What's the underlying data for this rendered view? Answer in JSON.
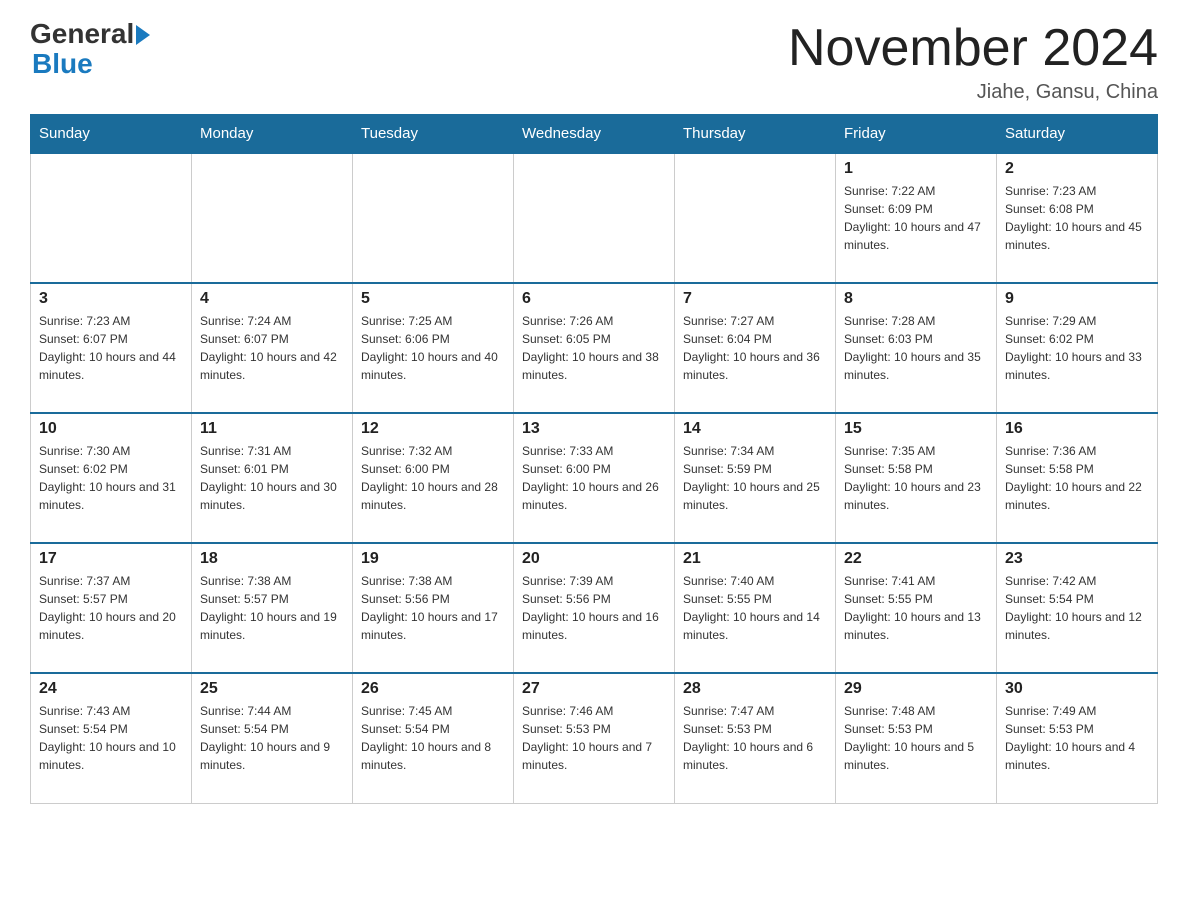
{
  "header": {
    "logo_general": "General",
    "logo_blue": "Blue",
    "month_title": "November 2024",
    "location": "Jiahe, Gansu, China"
  },
  "days_of_week": [
    "Sunday",
    "Monday",
    "Tuesday",
    "Wednesday",
    "Thursday",
    "Friday",
    "Saturday"
  ],
  "weeks": [
    [
      {
        "day": "",
        "info": ""
      },
      {
        "day": "",
        "info": ""
      },
      {
        "day": "",
        "info": ""
      },
      {
        "day": "",
        "info": ""
      },
      {
        "day": "",
        "info": ""
      },
      {
        "day": "1",
        "info": "Sunrise: 7:22 AM\nSunset: 6:09 PM\nDaylight: 10 hours and 47 minutes."
      },
      {
        "day": "2",
        "info": "Sunrise: 7:23 AM\nSunset: 6:08 PM\nDaylight: 10 hours and 45 minutes."
      }
    ],
    [
      {
        "day": "3",
        "info": "Sunrise: 7:23 AM\nSunset: 6:07 PM\nDaylight: 10 hours and 44 minutes."
      },
      {
        "day": "4",
        "info": "Sunrise: 7:24 AM\nSunset: 6:07 PM\nDaylight: 10 hours and 42 minutes."
      },
      {
        "day": "5",
        "info": "Sunrise: 7:25 AM\nSunset: 6:06 PM\nDaylight: 10 hours and 40 minutes."
      },
      {
        "day": "6",
        "info": "Sunrise: 7:26 AM\nSunset: 6:05 PM\nDaylight: 10 hours and 38 minutes."
      },
      {
        "day": "7",
        "info": "Sunrise: 7:27 AM\nSunset: 6:04 PM\nDaylight: 10 hours and 36 minutes."
      },
      {
        "day": "8",
        "info": "Sunrise: 7:28 AM\nSunset: 6:03 PM\nDaylight: 10 hours and 35 minutes."
      },
      {
        "day": "9",
        "info": "Sunrise: 7:29 AM\nSunset: 6:02 PM\nDaylight: 10 hours and 33 minutes."
      }
    ],
    [
      {
        "day": "10",
        "info": "Sunrise: 7:30 AM\nSunset: 6:02 PM\nDaylight: 10 hours and 31 minutes."
      },
      {
        "day": "11",
        "info": "Sunrise: 7:31 AM\nSunset: 6:01 PM\nDaylight: 10 hours and 30 minutes."
      },
      {
        "day": "12",
        "info": "Sunrise: 7:32 AM\nSunset: 6:00 PM\nDaylight: 10 hours and 28 minutes."
      },
      {
        "day": "13",
        "info": "Sunrise: 7:33 AM\nSunset: 6:00 PM\nDaylight: 10 hours and 26 minutes."
      },
      {
        "day": "14",
        "info": "Sunrise: 7:34 AM\nSunset: 5:59 PM\nDaylight: 10 hours and 25 minutes."
      },
      {
        "day": "15",
        "info": "Sunrise: 7:35 AM\nSunset: 5:58 PM\nDaylight: 10 hours and 23 minutes."
      },
      {
        "day": "16",
        "info": "Sunrise: 7:36 AM\nSunset: 5:58 PM\nDaylight: 10 hours and 22 minutes."
      }
    ],
    [
      {
        "day": "17",
        "info": "Sunrise: 7:37 AM\nSunset: 5:57 PM\nDaylight: 10 hours and 20 minutes."
      },
      {
        "day": "18",
        "info": "Sunrise: 7:38 AM\nSunset: 5:57 PM\nDaylight: 10 hours and 19 minutes."
      },
      {
        "day": "19",
        "info": "Sunrise: 7:38 AM\nSunset: 5:56 PM\nDaylight: 10 hours and 17 minutes."
      },
      {
        "day": "20",
        "info": "Sunrise: 7:39 AM\nSunset: 5:56 PM\nDaylight: 10 hours and 16 minutes."
      },
      {
        "day": "21",
        "info": "Sunrise: 7:40 AM\nSunset: 5:55 PM\nDaylight: 10 hours and 14 minutes."
      },
      {
        "day": "22",
        "info": "Sunrise: 7:41 AM\nSunset: 5:55 PM\nDaylight: 10 hours and 13 minutes."
      },
      {
        "day": "23",
        "info": "Sunrise: 7:42 AM\nSunset: 5:54 PM\nDaylight: 10 hours and 12 minutes."
      }
    ],
    [
      {
        "day": "24",
        "info": "Sunrise: 7:43 AM\nSunset: 5:54 PM\nDaylight: 10 hours and 10 minutes."
      },
      {
        "day": "25",
        "info": "Sunrise: 7:44 AM\nSunset: 5:54 PM\nDaylight: 10 hours and 9 minutes."
      },
      {
        "day": "26",
        "info": "Sunrise: 7:45 AM\nSunset: 5:54 PM\nDaylight: 10 hours and 8 minutes."
      },
      {
        "day": "27",
        "info": "Sunrise: 7:46 AM\nSunset: 5:53 PM\nDaylight: 10 hours and 7 minutes."
      },
      {
        "day": "28",
        "info": "Sunrise: 7:47 AM\nSunset: 5:53 PM\nDaylight: 10 hours and 6 minutes."
      },
      {
        "day": "29",
        "info": "Sunrise: 7:48 AM\nSunset: 5:53 PM\nDaylight: 10 hours and 5 minutes."
      },
      {
        "day": "30",
        "info": "Sunrise: 7:49 AM\nSunset: 5:53 PM\nDaylight: 10 hours and 4 minutes."
      }
    ]
  ]
}
